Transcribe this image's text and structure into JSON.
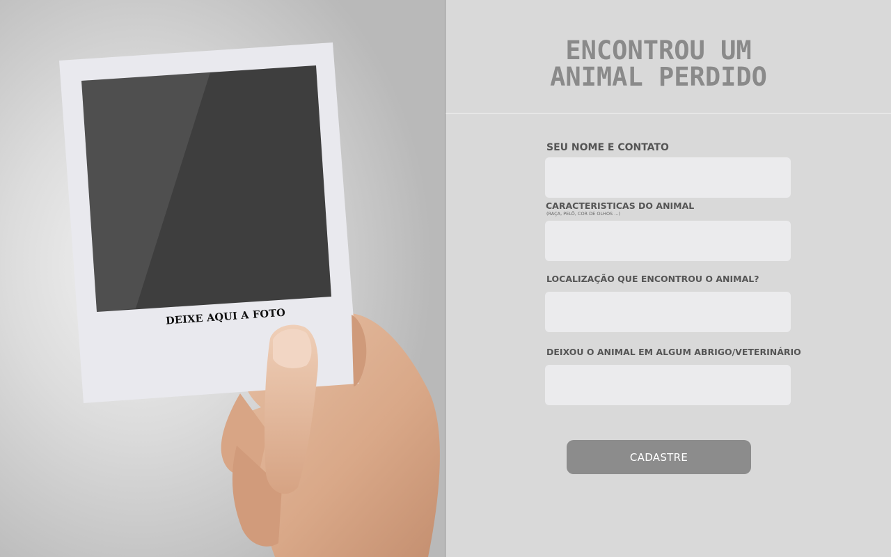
{
  "photo_card": {
    "caption": "DEIXE AQUI A FOTO"
  },
  "header": {
    "title_line1": "ENCONTROU UM",
    "title_line2": "ANIMAL PERDIDO"
  },
  "form": {
    "fields": [
      {
        "label": "SEU NOME E CONTATO",
        "hint": "",
        "value": "",
        "placeholder": ""
      },
      {
        "label": "CARACTERISTICAS DO ANIMAL",
        "hint": "(RAÇA, PELÔ, COR DE OLHOS ...)",
        "value": "",
        "placeholder": ""
      },
      {
        "label": "LOCALIZAÇÃO QUE ENCONTROU O ANIMAL?",
        "hint": "",
        "value": "",
        "placeholder": ""
      },
      {
        "label": "DEIXOU O ANIMAL EM ALGUM ABRIGO/VETERINÁRIO",
        "hint": "",
        "value": "",
        "placeholder": ""
      }
    ],
    "submit_label": "CADASTRE"
  },
  "colors": {
    "panel_background": "#d9d9d9",
    "input_background": "#ebebed",
    "button_background": "#8c8c8c",
    "title_color": "#8a8a8a",
    "label_color": "#555555"
  }
}
